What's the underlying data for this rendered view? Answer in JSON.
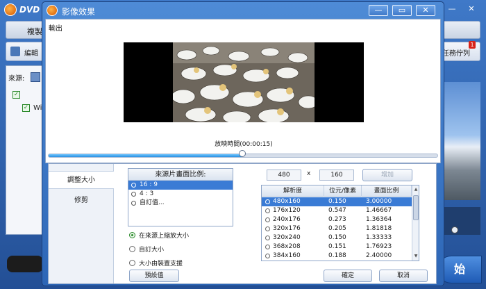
{
  "app": {
    "title": "DVD",
    "tab_label": "複製",
    "edit_label": "編輯",
    "queue_label": "任務佇列",
    "queue_badge": "1",
    "source_label": "來源:",
    "row_label": "Wi",
    "start_label": "始"
  },
  "dialog": {
    "title": "影像效果",
    "minimize": "—",
    "maximize": "▭",
    "close": "✕"
  },
  "output": {
    "label": "輸出",
    "duration": "放映時間(00:00:15)",
    "progress": 0.5
  },
  "tabs": [
    {
      "label": "調整大小",
      "active": true
    },
    {
      "label": "修剪",
      "active": false
    }
  ],
  "aspect": {
    "header": "來源片畫面比例:",
    "options": [
      {
        "label": "16 : 9",
        "selected": true
      },
      {
        "label": "4 : 3",
        "selected": false
      },
      {
        "label": "自訂值...",
        "selected": false
      }
    ]
  },
  "resize_options": [
    {
      "label": "在來源上縮放大小",
      "checked": true
    },
    {
      "label": "自訂大小",
      "checked": false
    },
    {
      "label": "大小由裝置支援",
      "checked": false
    }
  ],
  "size": {
    "width": "480",
    "times": "x",
    "height": "160"
  },
  "buttons": {
    "add": "增加",
    "default": "預設值",
    "ok": "確定",
    "cancel": "取消"
  },
  "table": {
    "headers": [
      "解析度",
      "位元/像素",
      "畫面比例"
    ],
    "rows": [
      {
        "res": "480x160",
        "bpp": "0.150",
        "ratio": "3.00000",
        "selected": true
      },
      {
        "res": "176x120",
        "bpp": "0.547",
        "ratio": "1.46667",
        "selected": false
      },
      {
        "res": "240x176",
        "bpp": "0.273",
        "ratio": "1.36364",
        "selected": false
      },
      {
        "res": "320x176",
        "bpp": "0.205",
        "ratio": "1.81818",
        "selected": false
      },
      {
        "res": "320x240",
        "bpp": "0.150",
        "ratio": "1.33333",
        "selected": false
      },
      {
        "res": "368x208",
        "bpp": "0.151",
        "ratio": "1.76923",
        "selected": false
      },
      {
        "res": "384x160",
        "bpp": "0.188",
        "ratio": "2.40000",
        "selected": false
      }
    ]
  },
  "colors": {
    "accent": "#3a7bd5",
    "dialog_frame": "#2d66b6"
  }
}
